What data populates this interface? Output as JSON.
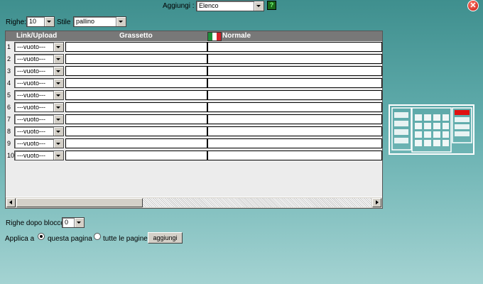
{
  "header": {
    "add_label": "Aggiungi :",
    "add_value": "Elenco",
    "help_glyph": "?",
    "close_glyph": "✕"
  },
  "options": {
    "rows_label": "Righe:",
    "rows_value": "10",
    "style_label": "Stile",
    "style_value": "pallino"
  },
  "table": {
    "columns": [
      "Link/Upload",
      "Grassetto",
      "Normale"
    ],
    "rows": [
      {
        "num": "1",
        "link": "---vuoto---"
      },
      {
        "num": "2",
        "link": "---vuoto---"
      },
      {
        "num": "3",
        "link": "---vuoto---"
      },
      {
        "num": "4",
        "link": "---vuoto---"
      },
      {
        "num": "5",
        "link": "---vuoto---"
      },
      {
        "num": "6",
        "link": "---vuoto---"
      },
      {
        "num": "7",
        "link": "---vuoto---"
      },
      {
        "num": "8",
        "link": "---vuoto---"
      },
      {
        "num": "9",
        "link": "---vuoto---"
      },
      {
        "num": "10",
        "link": "---vuoto---"
      }
    ]
  },
  "footer": {
    "after_block_label": "Righe dopo blocco",
    "after_block_value": "0",
    "apply_label": "Applica a",
    "option_this_page": "questa pagina",
    "option_all_pages": "tutte le pagine",
    "add_button": "aggiungi",
    "selected_option": "questa pagina"
  },
  "colors": {
    "bg_top": "#3f8f8e",
    "bg_bottom": "#a4d3d2",
    "header_row": "#787878",
    "close_red": "#c4160e"
  },
  "icons": [
    "help-icon",
    "close-icon",
    "italian-flag-icon",
    "layout-preview-icon"
  ]
}
